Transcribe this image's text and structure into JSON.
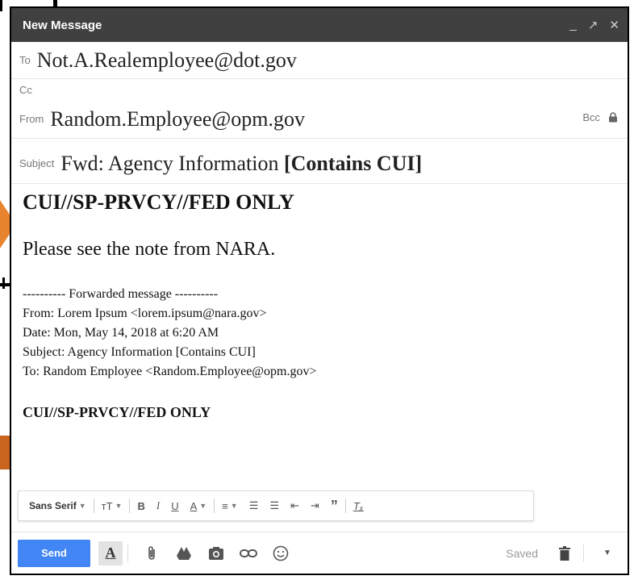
{
  "window": {
    "title": "New Message",
    "controls": {
      "minimize": "_",
      "expand": "↗",
      "close": "✕"
    }
  },
  "to": {
    "label": "To",
    "value": "Not.A.Realemployee@dot.gov"
  },
  "cc": {
    "label": "Cc"
  },
  "from": {
    "label": "From",
    "value": "Random.Employee@opm.gov",
    "bcc_label": "Bcc"
  },
  "subject": {
    "label": "Subject",
    "value": "Fwd: Agency Information ",
    "marking": "[Contains CUI]"
  },
  "body": {
    "banner": "CUI//SP-PRVCY//FED ONLY",
    "message": "Please see the note from NARA.",
    "forwarded": {
      "header": "---------- Forwarded message ----------",
      "from": "From: Lorem Ipsum <lorem.ipsum@nara.gov>",
      "date": "Date: Mon, May 14, 2018 at 6:20 AM",
      "subject": "Subject: Agency Information [Contains CUI]",
      "to": "To: Random Employee <Random.Employee@opm.gov>"
    },
    "banner2": "CUI//SP-PRVCY//FED ONLY"
  },
  "format_toolbar": {
    "font": "Sans Serif",
    "size_icon": "тT",
    "bold": "B",
    "italic": "I",
    "underline": "U",
    "text_color": "A",
    "align": "≡",
    "numbered_list": "☰",
    "bulleted_list": "☰",
    "indent_less": "⇤",
    "indent_more": "⇥",
    "quote": "”",
    "clear": "Tₓ"
  },
  "bottom_bar": {
    "send_label": "Send",
    "format_label": "A",
    "saved_label": "Saved",
    "icons": [
      "paperclip-icon",
      "drive-icon",
      "photo-icon",
      "link-icon",
      "emoji-icon",
      "trash-icon",
      "more-options-icon"
    ]
  },
  "colors": {
    "send": "#4285f4",
    "titlebar": "#404040",
    "callout": "#e8842e"
  }
}
